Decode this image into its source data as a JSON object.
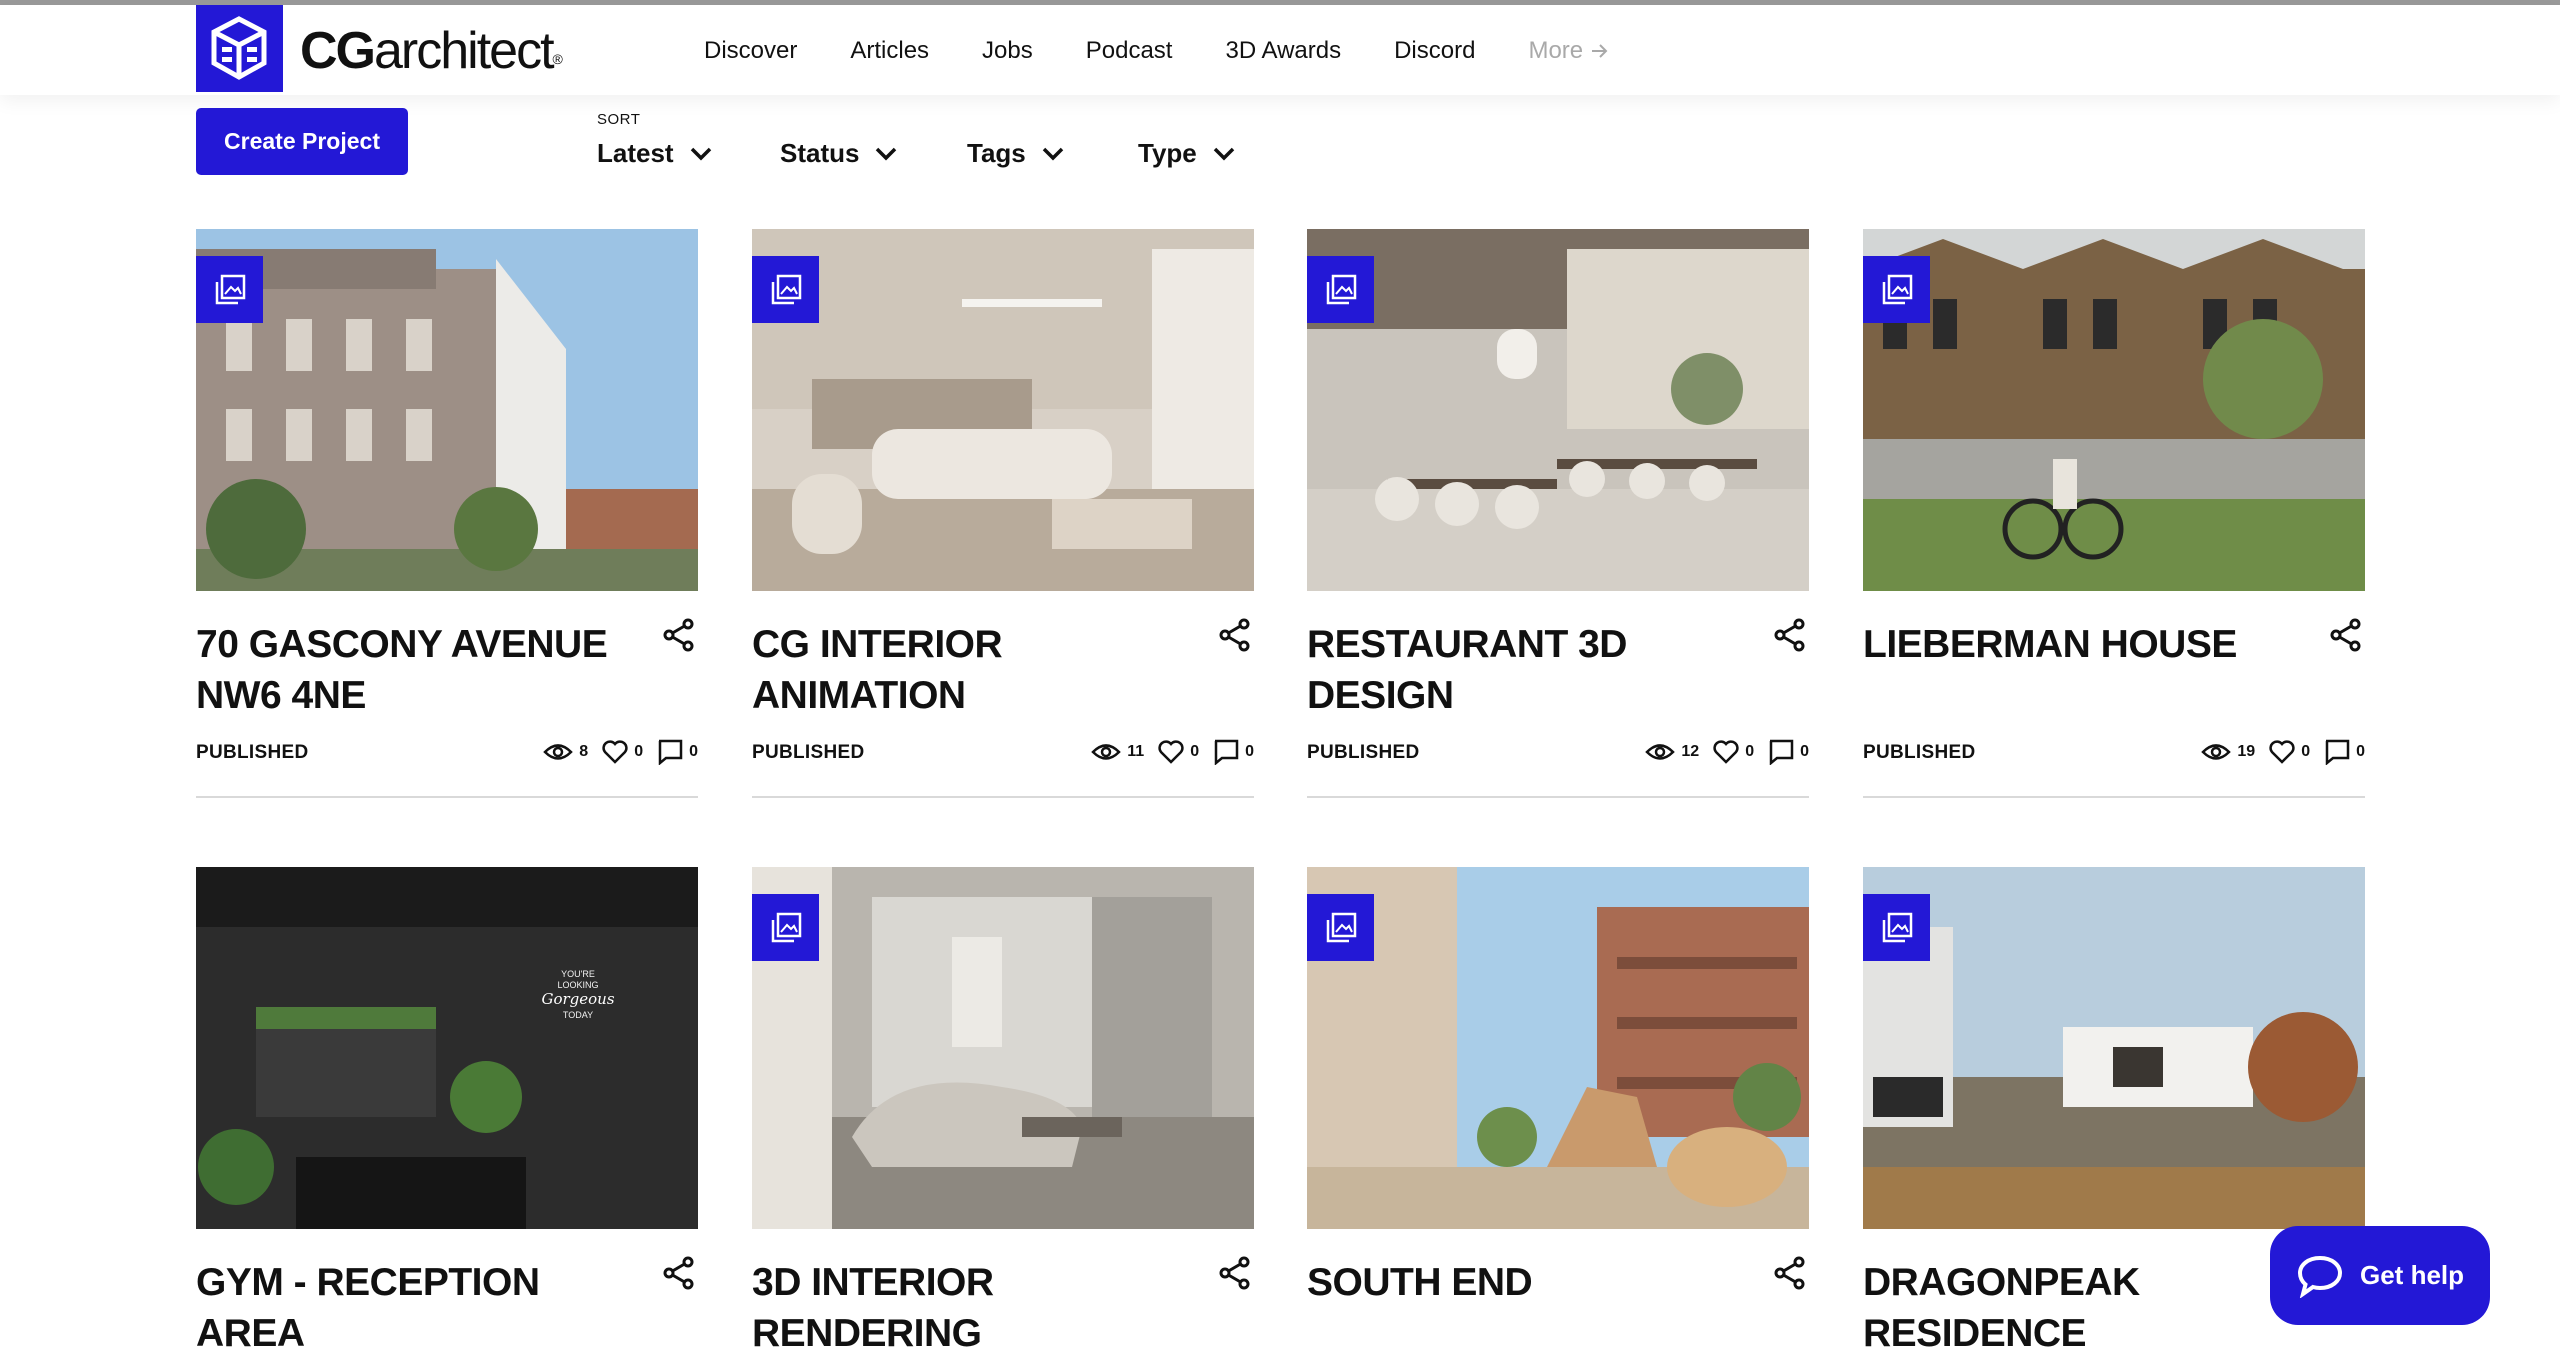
{
  "header": {
    "logo_text_bold": "CG",
    "logo_text_rest": "architect",
    "logo_mark": "®",
    "nav": [
      "Discover",
      "Articles",
      "Jobs",
      "Podcast",
      "3D Awards",
      "Discord"
    ],
    "nav_more": "More"
  },
  "toolbar": {
    "create_label": "Create Project",
    "sort_label": "SORT",
    "sort_value": "Latest",
    "filters": [
      "Status",
      "Tags",
      "Type"
    ]
  },
  "projects": [
    {
      "title": "70 GASCONY AVENUE NW6 4NE",
      "status": "PUBLISHED",
      "views": "8",
      "likes": "0",
      "comments": "0",
      "has_gallery_icon": true
    },
    {
      "title": "CG INTERIOR ANIMATION",
      "status": "PUBLISHED",
      "views": "11",
      "likes": "0",
      "comments": "0",
      "has_gallery_icon": true
    },
    {
      "title": "RESTAURANT 3D DESIGN",
      "status": "PUBLISHED",
      "views": "12",
      "likes": "0",
      "comments": "0",
      "has_gallery_icon": true
    },
    {
      "title": "LIEBERMAN HOUSE",
      "status": "PUBLISHED",
      "views": "19",
      "likes": "0",
      "comments": "0",
      "has_gallery_icon": true
    },
    {
      "title": "GYM - RECEPTION AREA",
      "has_gallery_icon": false,
      "image_sign_text": [
        "YOU'RE",
        "LOOKING",
        "Gorgeous",
        "TODAY"
      ]
    },
    {
      "title": "3D INTERIOR RENDERING",
      "has_gallery_icon": true
    },
    {
      "title": "SOUTH END",
      "has_gallery_icon": true
    },
    {
      "title": "DRAGONPEAK RESIDENCE",
      "has_gallery_icon": true
    }
  ],
  "help": {
    "label": "Get help"
  },
  "colors": {
    "brand": "#2318d6",
    "text": "#111111",
    "muted": "#a9a9a9",
    "divider": "#d9d9d9"
  },
  "icons": [
    "logo-cube-icon",
    "arrow-right-icon",
    "chevron-down-icon",
    "gallery-icon",
    "share-icon",
    "eye-icon",
    "heart-icon",
    "comment-icon",
    "chat-bubble-icon"
  ]
}
